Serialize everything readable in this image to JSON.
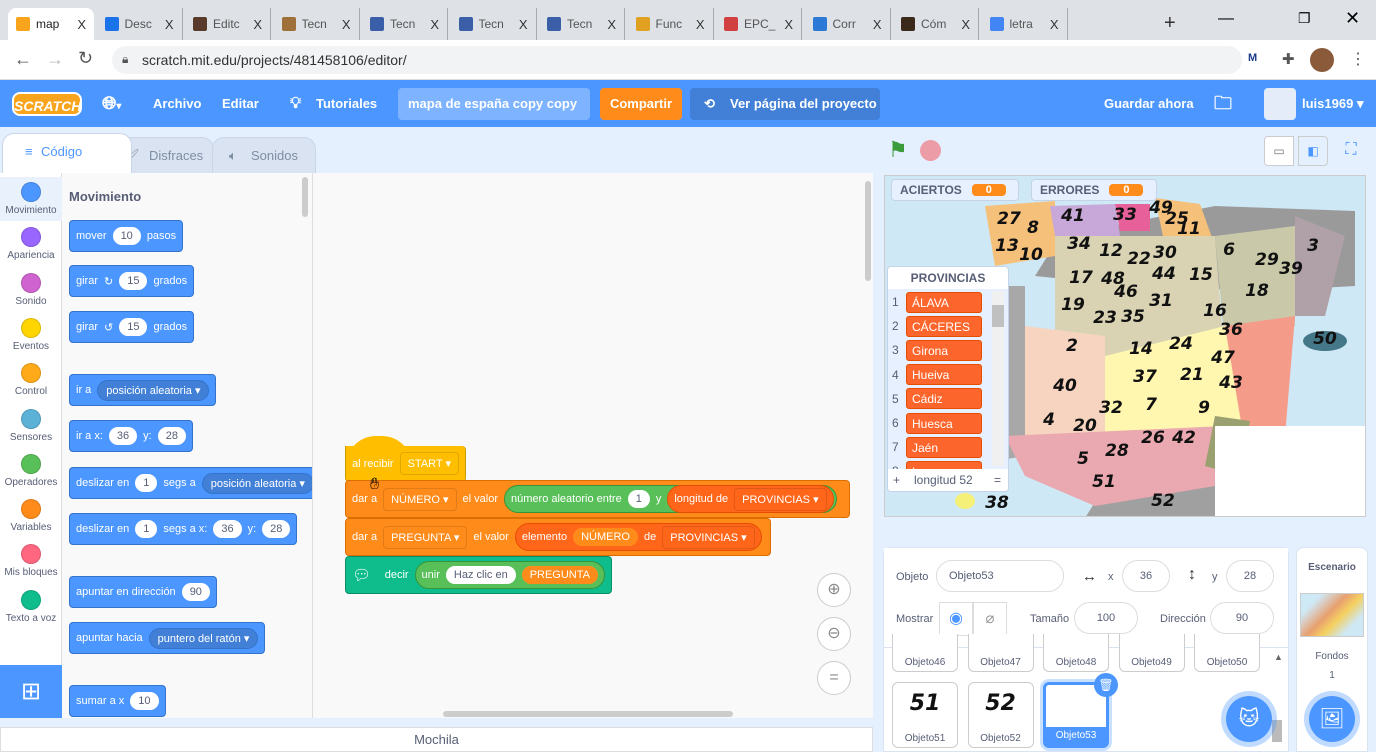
{
  "browser": {
    "tabs": [
      {
        "title": "map",
        "color": "#f8a51d",
        "active": true
      },
      {
        "title": "Desc",
        "color": "#1a73e8"
      },
      {
        "title": "Editc",
        "color": "#5a3a2a"
      },
      {
        "title": "Tecn",
        "color": "#a0703a"
      },
      {
        "title": "Tecn",
        "color": "#3a5fa8"
      },
      {
        "title": "Tecn",
        "color": "#3a5fa8"
      },
      {
        "title": "Tecn",
        "color": "#3a5fa8"
      },
      {
        "title": "Func",
        "color": "#e0a020"
      },
      {
        "title": "EPC_",
        "color": "#d04040"
      },
      {
        "title": "Corr",
        "color": "#2a7ad6"
      },
      {
        "title": "Cóm",
        "color": "#3a2a1a"
      },
      {
        "title": "letra",
        "color": "#4285f4"
      }
    ],
    "close_glyph": "X",
    "new_tab": "+",
    "url": "scratch.mit.edu/projects/481458106/editor/"
  },
  "menu": {
    "logo": "SCRATCH",
    "archivo": "Archivo",
    "editar": "Editar",
    "tutoriales": "Tutoriales",
    "project_title": "mapa de españa copy copy",
    "share": "Compartir",
    "see_project": "Ver página del proyecto",
    "save_now": "Guardar ahora",
    "user": "luis1969"
  },
  "editor_tabs": [
    "Código",
    "Disfraces",
    "Sonidos"
  ],
  "categories": [
    {
      "label": "Movimiento",
      "color": "#4c97ff"
    },
    {
      "label": "Apariencia",
      "color": "#9966ff"
    },
    {
      "label": "Sonido",
      "color": "#cf63cf"
    },
    {
      "label": "Eventos",
      "color": "#ffd500"
    },
    {
      "label": "Control",
      "color": "#ffab19"
    },
    {
      "label": "Sensores",
      "color": "#5cb1d6"
    },
    {
      "label": "Operadores",
      "color": "#59c059"
    },
    {
      "label": "Variables",
      "color": "#ff8c1a"
    },
    {
      "label": "Mis bloques",
      "color": "#ff6680"
    },
    {
      "label": "Texto a voz",
      "color": "#0fbd8c"
    }
  ],
  "palette": {
    "heading": "Movimiento",
    "move": {
      "a": "mover",
      "v": "10",
      "b": "pasos"
    },
    "turn_right": {
      "a": "girar",
      "v": "15",
      "b": "grados"
    },
    "turn_left": {
      "a": "girar",
      "v": "15",
      "b": "grados"
    },
    "goto": {
      "a": "ir a",
      "d": "posición aleatoria"
    },
    "goto_xy": {
      "a": "ir a x:",
      "x": "36",
      "b": "y:",
      "y": "28"
    },
    "glide": {
      "a": "deslizar en",
      "v": "1",
      "b": "segs a",
      "d": "posición aleatoria"
    },
    "glide_xy": {
      "a": "deslizar en",
      "v": "1",
      "b": "segs a x:",
      "x": "36",
      "c": "y:",
      "y": "28"
    },
    "point_dir": {
      "a": "apuntar en dirección",
      "v": "90"
    },
    "point_to": {
      "a": "apuntar hacia",
      "d": "puntero del ratón"
    },
    "change_x": {
      "a": "sumar a x",
      "v": "10"
    }
  },
  "script": {
    "hat": {
      "a": "al recibir",
      "d": "START"
    },
    "set1": {
      "a": "dar a",
      "var": "NÚMERO",
      "b": "el valor",
      "rand": "número aleatorio entre",
      "from": "1",
      "y": "y",
      "len": "longitud de",
      "list": "PROVINCIAS"
    },
    "set2": {
      "a": "dar a",
      "var": "PREGUNTA",
      "b": "el valor",
      "item": "elemento",
      "idx": "NÚMERO",
      "de": "de",
      "list": "PROVINCIAS"
    },
    "say": {
      "a": "decir",
      "join": "unir",
      "text": "Haz clic en",
      "var": "PREGUNTA"
    }
  },
  "mochila": "Mochila",
  "stage": {
    "monitors": [
      {
        "label": "ACIERTOS",
        "value": "0"
      },
      {
        "label": "ERRORES",
        "value": "0"
      }
    ],
    "list": {
      "title": "PROVINCIAS",
      "items": [
        "ÁLAVA",
        "CÁCERES",
        "Girona",
        "Hueiva",
        "Cádiz",
        "Huesca",
        "Jaén",
        "Lugo"
      ],
      "add": "+",
      "length": "longitud 52",
      "resize": "="
    },
    "map_labels": [
      "27",
      "8",
      "41",
      "33",
      "49",
      "25",
      "11",
      "13",
      "10",
      "34",
      "12",
      "22",
      "30",
      "6",
      "3",
      "29",
      "39",
      "17",
      "48",
      "44",
      "15",
      "18",
      "46",
      "31",
      "19",
      "16",
      "23",
      "35",
      "36",
      "50",
      "2",
      "14",
      "24",
      "47",
      "37",
      "21",
      "43",
      "40",
      "9",
      "32",
      "7",
      "4",
      "20",
      "26",
      "42",
      "28",
      "5",
      "51",
      "52",
      "38"
    ]
  },
  "sprite_info": {
    "sprite_label": "Objeto",
    "sprite_name": "Objeto53",
    "x_label": "x",
    "x": "36",
    "y_label": "y",
    "y": "28",
    "show_label": "Mostrar",
    "size_label": "Tamaño",
    "size": "100",
    "direction_label": "Dirección",
    "direction": "90"
  },
  "sprites": [
    {
      "name": "Objeto46"
    },
    {
      "name": "Objeto47"
    },
    {
      "name": "Objeto48"
    },
    {
      "name": "Objeto49"
    },
    {
      "name": "Objeto50"
    },
    {
      "name": "Objeto51",
      "glyph": "51"
    },
    {
      "name": "Objeto52",
      "glyph": "52"
    },
    {
      "name": "Objeto53",
      "selected": true
    }
  ],
  "stage_pane": {
    "title": "Escenario",
    "backdrops_label": "Fondos",
    "backdrops_count": "1"
  }
}
